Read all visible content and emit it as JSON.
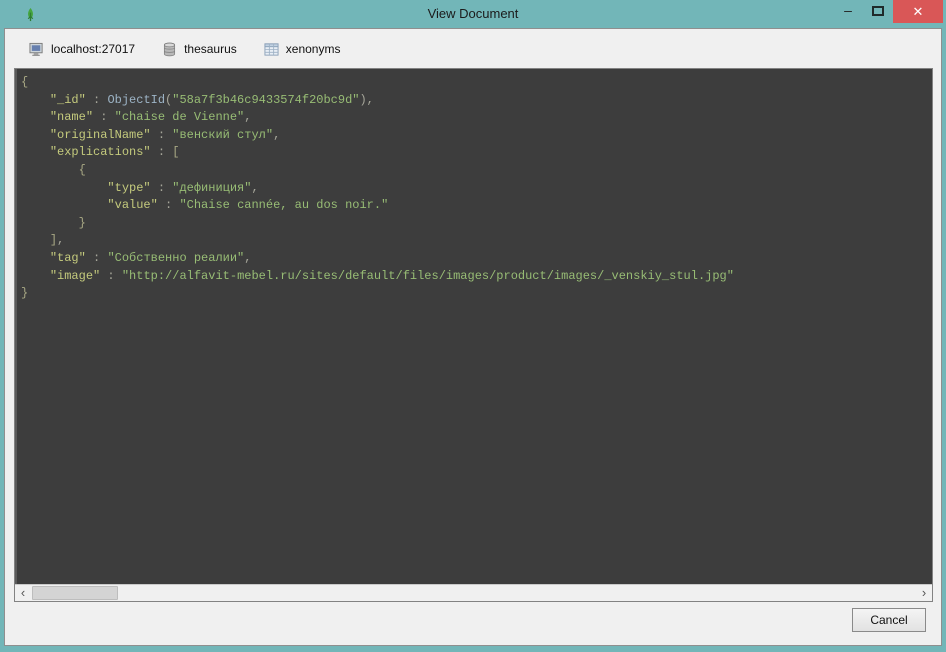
{
  "window": {
    "title": "View Document",
    "controls": {
      "minimize": "–",
      "close": "✕"
    }
  },
  "breadcrumb": {
    "items": [
      {
        "icon": "server-icon",
        "label": "localhost:27017"
      },
      {
        "icon": "database-icon",
        "label": "thesaurus"
      },
      {
        "icon": "collection-icon",
        "label": "xenonyms"
      }
    ]
  },
  "editor": {
    "language": "mongodb-json",
    "lines": [
      [
        {
          "t": "b",
          "v": "{"
        }
      ],
      [
        {
          "t": "p",
          "v": "    "
        },
        {
          "t": "k",
          "v": "\"_id\""
        },
        {
          "t": "p",
          "v": " : "
        },
        {
          "t": "f",
          "v": "ObjectId"
        },
        {
          "t": "p",
          "v": "("
        },
        {
          "t": "s",
          "v": "\"58a7f3b46c9433574f20bc9d\""
        },
        {
          "t": "p",
          "v": "),"
        }
      ],
      [
        {
          "t": "p",
          "v": "    "
        },
        {
          "t": "k",
          "v": "\"name\""
        },
        {
          "t": "p",
          "v": " : "
        },
        {
          "t": "s",
          "v": "\"chaise de Vienne\""
        },
        {
          "t": "p",
          "v": ","
        }
      ],
      [
        {
          "t": "p",
          "v": "    "
        },
        {
          "t": "k",
          "v": "\"originalName\""
        },
        {
          "t": "p",
          "v": " : "
        },
        {
          "t": "s",
          "v": "\"венский стул\""
        },
        {
          "t": "p",
          "v": ","
        }
      ],
      [
        {
          "t": "p",
          "v": "    "
        },
        {
          "t": "k",
          "v": "\"explications\""
        },
        {
          "t": "p",
          "v": " : "
        },
        {
          "t": "b",
          "v": "["
        }
      ],
      [
        {
          "t": "p",
          "v": "        "
        },
        {
          "t": "b",
          "v": "{"
        }
      ],
      [
        {
          "t": "p",
          "v": "            "
        },
        {
          "t": "k",
          "v": "\"type\""
        },
        {
          "t": "p",
          "v": " : "
        },
        {
          "t": "s",
          "v": "\"дефиниция\""
        },
        {
          "t": "p",
          "v": ","
        }
      ],
      [
        {
          "t": "p",
          "v": "            "
        },
        {
          "t": "k",
          "v": "\"value\""
        },
        {
          "t": "p",
          "v": " : "
        },
        {
          "t": "s",
          "v": "\"Chaise cannée, au dos noir.\""
        }
      ],
      [
        {
          "t": "p",
          "v": "        "
        },
        {
          "t": "b",
          "v": "}"
        }
      ],
      [
        {
          "t": "p",
          "v": "    "
        },
        {
          "t": "b",
          "v": "]"
        },
        {
          "t": "p",
          "v": ","
        }
      ],
      [
        {
          "t": "p",
          "v": "    "
        },
        {
          "t": "k",
          "v": "\"tag\""
        },
        {
          "t": "p",
          "v": " : "
        },
        {
          "t": "s",
          "v": "\"Собственно реалии\""
        },
        {
          "t": "p",
          "v": ","
        }
      ],
      [
        {
          "t": "p",
          "v": "    "
        },
        {
          "t": "k",
          "v": "\"image\""
        },
        {
          "t": "p",
          "v": " : "
        },
        {
          "t": "s",
          "v": "\"http://alfavit-mebel.ru/sites/default/files/images/product/images/_venskiy_stul.jpg\""
        }
      ],
      [
        {
          "t": "b",
          "v": "}"
        }
      ]
    ]
  },
  "scrollbar": {
    "left_arrow": "‹",
    "right_arrow": "›"
  },
  "footer": {
    "cancel_label": "Cancel"
  },
  "colors": {
    "titlebar": "#72b6b8",
    "close_button": "#d95757",
    "editor_background": "#3d3d3d",
    "key": "#c4ca7d",
    "string": "#98bd75",
    "objectid": "#9db4c6",
    "content_background": "#f0f0f0"
  }
}
